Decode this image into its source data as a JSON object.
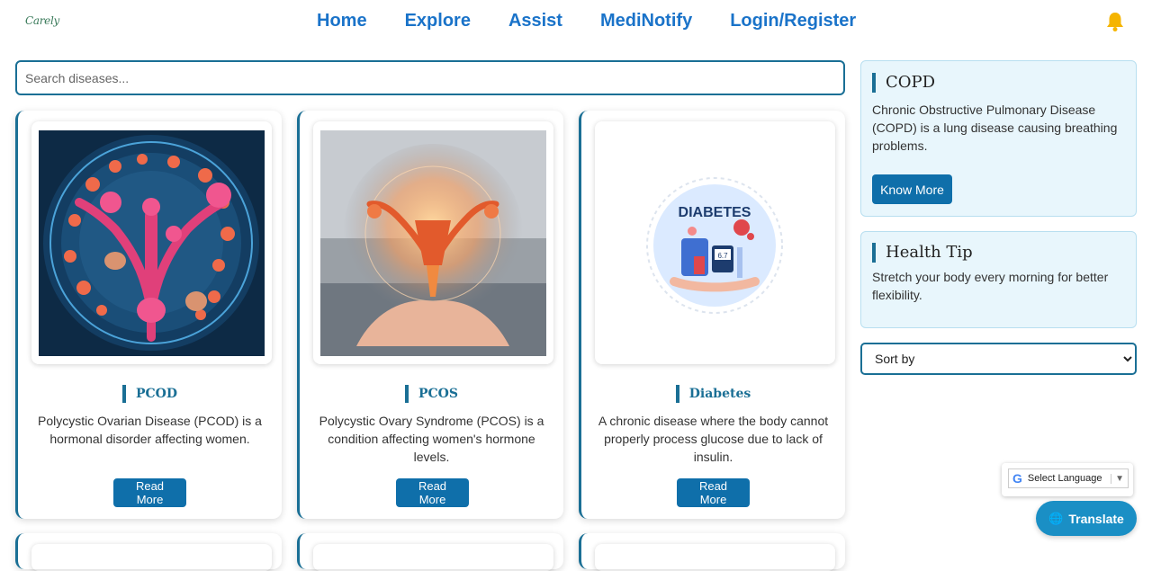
{
  "logo": {
    "text": "Carely"
  },
  "nav": {
    "items": [
      "Home",
      "Explore",
      "Assist",
      "MediNotify",
      "Login/Register"
    ]
  },
  "header": {
    "bell_icon": "bell-icon"
  },
  "search": {
    "placeholder": "Search diseases..."
  },
  "cards": [
    {
      "title": "PCOD",
      "description": "Polycystic Ovarian Disease (PCOD) is a hormonal disorder affecting women.",
      "button": "Read More"
    },
    {
      "title": "PCOS",
      "description": "Polycystic Ovary Syndrome (PCOS) is a condition affecting women's hormone levels.",
      "button": "Read More"
    },
    {
      "title": "Diabetes",
      "description": "A chronic disease where the body cannot properly process glucose due to lack of insulin.",
      "button": "Read More",
      "image_text": "DIABETES",
      "image_reading": "6.7"
    }
  ],
  "sidebar": {
    "featured": {
      "title": "COPD",
      "text": "Chronic Obstructive Pulmonary Disease (COPD) is a lung disease causing breathing problems.",
      "button": "Know More"
    },
    "tip": {
      "title": "Health Tip",
      "text": "Stretch your body every morning for better flexibility."
    },
    "sort": {
      "selected": "Sort by"
    }
  },
  "translate": {
    "widget_label": "Select Language",
    "button": "Translate"
  },
  "colors": {
    "accent": "#1a6f95",
    "nav": "#1a73c9",
    "button": "#0f6faa",
    "sidebar_bg": "#e8f6fc"
  }
}
